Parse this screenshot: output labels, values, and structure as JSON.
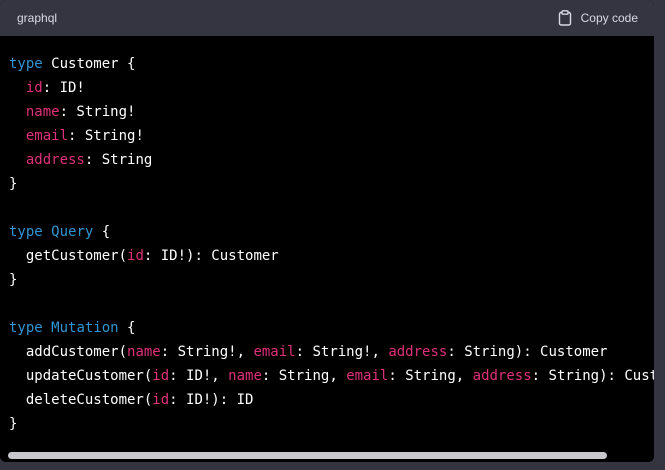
{
  "header": {
    "language": "graphql",
    "copy_label": "Copy code",
    "copy_icon": "clipboard-icon"
  },
  "colors": {
    "keyword": "#2e95d3",
    "field": "#df3079",
    "text": "#ffffff",
    "background": "#000000",
    "header_bg": "#343541"
  },
  "code": {
    "lines": [
      [
        {
          "t": "type",
          "k": "keyword"
        },
        {
          "t": " ",
          "k": "plain"
        },
        {
          "t": "Customer",
          "k": "plain"
        },
        {
          "t": " {",
          "k": "plain"
        }
      ],
      [
        {
          "t": "  ",
          "k": "plain"
        },
        {
          "t": "id",
          "k": "field"
        },
        {
          "t": ": ID!",
          "k": "plain"
        }
      ],
      [
        {
          "t": "  ",
          "k": "plain"
        },
        {
          "t": "name",
          "k": "field"
        },
        {
          "t": ": String!",
          "k": "plain"
        }
      ],
      [
        {
          "t": "  ",
          "k": "plain"
        },
        {
          "t": "email",
          "k": "field"
        },
        {
          "t": ": String!",
          "k": "plain"
        }
      ],
      [
        {
          "t": "  ",
          "k": "plain"
        },
        {
          "t": "address",
          "k": "field"
        },
        {
          "t": ": String",
          "k": "plain"
        }
      ],
      [
        {
          "t": "}",
          "k": "plain"
        }
      ],
      [],
      [
        {
          "t": "type",
          "k": "keyword"
        },
        {
          "t": " ",
          "k": "plain"
        },
        {
          "t": "Query",
          "k": "typename"
        },
        {
          "t": " {",
          "k": "plain"
        }
      ],
      [
        {
          "t": "  getCustomer(",
          "k": "plain"
        },
        {
          "t": "id",
          "k": "arg"
        },
        {
          "t": ": ID!): Customer",
          "k": "plain"
        }
      ],
      [
        {
          "t": "}",
          "k": "plain"
        }
      ],
      [],
      [
        {
          "t": "type",
          "k": "keyword"
        },
        {
          "t": " ",
          "k": "plain"
        },
        {
          "t": "Mutation",
          "k": "typename"
        },
        {
          "t": " {",
          "k": "plain"
        }
      ],
      [
        {
          "t": "  addCustomer(",
          "k": "plain"
        },
        {
          "t": "name",
          "k": "arg"
        },
        {
          "t": ": String!, ",
          "k": "plain"
        },
        {
          "t": "email",
          "k": "arg"
        },
        {
          "t": ": String!, ",
          "k": "plain"
        },
        {
          "t": "address",
          "k": "arg"
        },
        {
          "t": ": String): Customer",
          "k": "plain"
        }
      ],
      [
        {
          "t": "  updateCustomer(",
          "k": "plain"
        },
        {
          "t": "id",
          "k": "arg"
        },
        {
          "t": ": ID!, ",
          "k": "plain"
        },
        {
          "t": "name",
          "k": "arg"
        },
        {
          "t": ": String, ",
          "k": "plain"
        },
        {
          "t": "email",
          "k": "arg"
        },
        {
          "t": ": String, ",
          "k": "plain"
        },
        {
          "t": "address",
          "k": "arg"
        },
        {
          "t": ": String): Cust",
          "k": "plain"
        }
      ],
      [
        {
          "t": "  deleteCustomer(",
          "k": "plain"
        },
        {
          "t": "id",
          "k": "arg"
        },
        {
          "t": ": ID!): ID",
          "k": "plain"
        }
      ],
      [
        {
          "t": "}",
          "k": "plain"
        }
      ]
    ]
  },
  "scrollbar": {
    "horizontal_position": 0,
    "visible_fraction": 0.92
  }
}
